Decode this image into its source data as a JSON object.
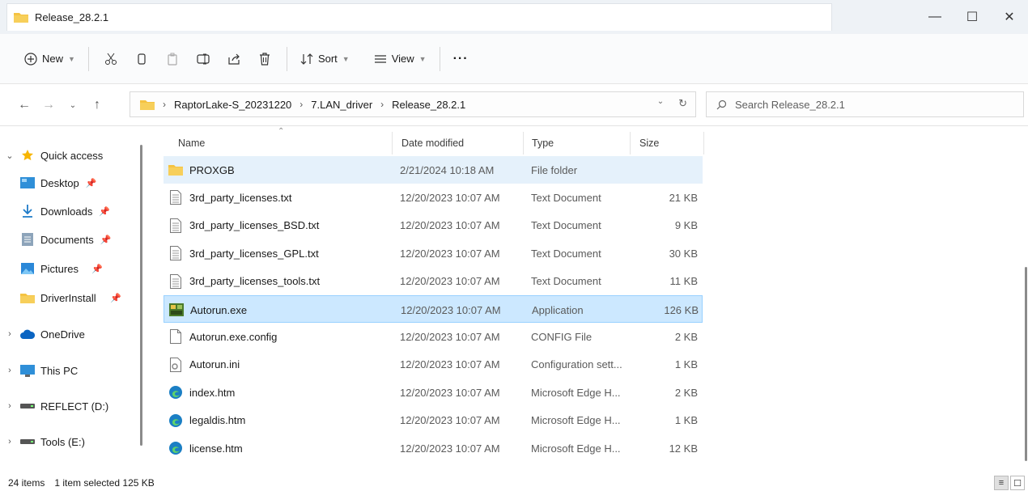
{
  "window": {
    "title": "Release_28.2.1"
  },
  "window_buttons": {
    "minimize": "—",
    "maximize": "☐",
    "close": "✕"
  },
  "toolbar": {
    "new_label": "New",
    "sort_label": "Sort",
    "view_label": "View",
    "more_label": "···"
  },
  "address": {
    "crumbs": [
      "RaptorLake-S_20231220",
      "7.LAN_driver",
      "Release_28.2.1"
    ],
    "search_placeholder": "Search Release_28.2.1"
  },
  "sidebar": {
    "items": [
      {
        "label": "Quick access",
        "icon": "star-icon"
      },
      {
        "label": "Desktop",
        "icon": "desktop-icon"
      },
      {
        "label": "Downloads",
        "icon": "download-icon"
      },
      {
        "label": "Documents",
        "icon": "documents-icon"
      },
      {
        "label": "Pictures",
        "icon": "pictures-icon"
      },
      {
        "label": "DriverInstall",
        "icon": "folder-icon"
      },
      {
        "label": "OneDrive",
        "icon": "cloud-icon"
      },
      {
        "label": "This PC",
        "icon": "monitor-icon"
      },
      {
        "label": "REFLECT (D:)",
        "icon": "drive-icon"
      },
      {
        "label": "Tools (E:)",
        "icon": "drive-icon"
      }
    ]
  },
  "columns": {
    "name": "Name",
    "date": "Date modified",
    "type": "Type",
    "size": "Size"
  },
  "files": [
    {
      "name": "PROXGB",
      "date": "2/21/2024 10:18 AM",
      "type": "File folder",
      "size": "",
      "icon": "folder-icon"
    },
    {
      "name": "3rd_party_licenses.txt",
      "date": "12/20/2023 10:07 AM",
      "type": "Text Document",
      "size": "21 KB",
      "icon": "text-file-icon"
    },
    {
      "name": "3rd_party_licenses_BSD.txt",
      "date": "12/20/2023 10:07 AM",
      "type": "Text Document",
      "size": "9 KB",
      "icon": "text-file-icon"
    },
    {
      "name": "3rd_party_licenses_GPL.txt",
      "date": "12/20/2023 10:07 AM",
      "type": "Text Document",
      "size": "30 KB",
      "icon": "text-file-icon"
    },
    {
      "name": "3rd_party_licenses_tools.txt",
      "date": "12/20/2023 10:07 AM",
      "type": "Text Document",
      "size": "11 KB",
      "icon": "text-file-icon"
    },
    {
      "name": "Autorun.exe",
      "date": "12/20/2023 10:07 AM",
      "type": "Application",
      "size": "126 KB",
      "icon": "application-icon"
    },
    {
      "name": "Autorun.exe.config",
      "date": "12/20/2023 10:07 AM",
      "type": "CONFIG File",
      "size": "2 KB",
      "icon": "blank-file-icon"
    },
    {
      "name": "Autorun.ini",
      "date": "12/20/2023 10:07 AM",
      "type": "Configuration sett...",
      "size": "1 KB",
      "icon": "ini-file-icon"
    },
    {
      "name": "index.htm",
      "date": "12/20/2023 10:07 AM",
      "type": "Microsoft Edge H...",
      "size": "2 KB",
      "icon": "edge-icon"
    },
    {
      "name": "legaldis.htm",
      "date": "12/20/2023 10:07 AM",
      "type": "Microsoft Edge H...",
      "size": "1 KB",
      "icon": "edge-icon"
    },
    {
      "name": "license.htm",
      "date": "12/20/2023 10:07 AM",
      "type": "Microsoft Edge H...",
      "size": "12 KB",
      "icon": "edge-icon"
    }
  ],
  "status": {
    "count": "24 items",
    "selection": "1 item selected  125 KB"
  },
  "colors": {
    "folder": "#f5c342",
    "selected": "#cce8ff",
    "hover": "#e5f1fb",
    "accent": "#0067c0"
  }
}
